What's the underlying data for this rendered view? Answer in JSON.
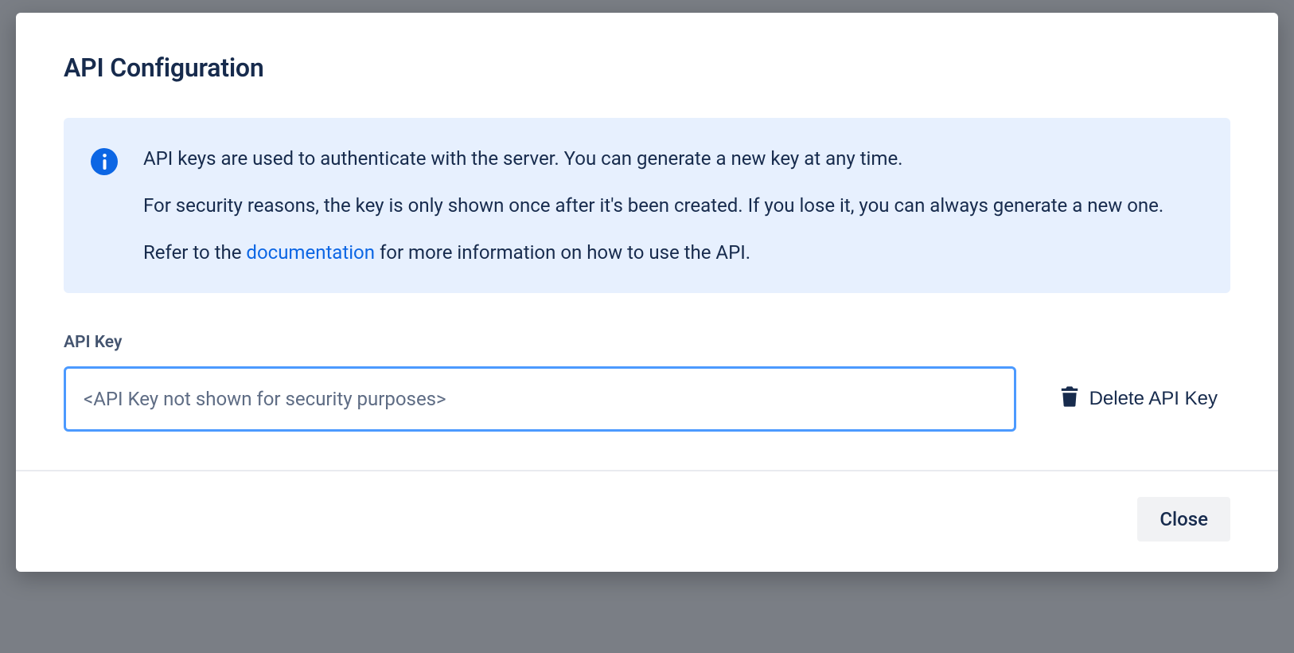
{
  "modal": {
    "title": "API Configuration",
    "info": {
      "p1": "API keys are used to authenticate with the server. You can generate a new key at any time.",
      "p2": "For security reasons, the key is only shown once after it's been created. If you lose it, you can always generate a new one.",
      "p3_before": "Refer to the ",
      "p3_link": "documentation",
      "p3_after": " for more information on how to use the API."
    },
    "field": {
      "label": "API Key",
      "value": "<API Key not shown for security purposes>",
      "delete_label": "Delete API Key"
    },
    "footer": {
      "close_label": "Close"
    }
  }
}
